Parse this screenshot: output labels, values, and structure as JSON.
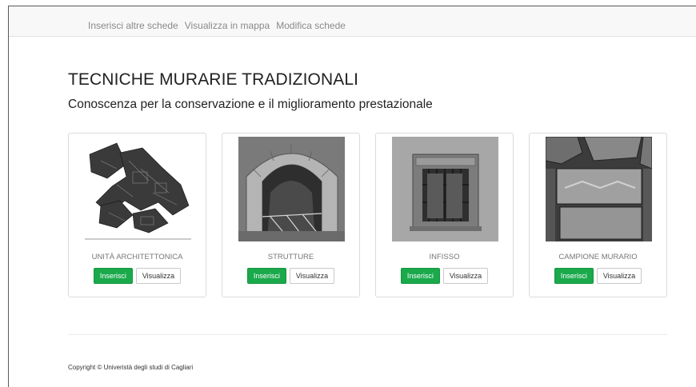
{
  "nav": {
    "links": [
      "Inserisci altre schede",
      "Visualizza in mappa",
      "Modifica schede"
    ]
  },
  "main": {
    "title": "TECNICHE MURARIE TRADIZIONALI",
    "subtitle": "Conoscenza per la conservazione e il miglioramento prestazionale"
  },
  "cards": [
    {
      "label": "UNITÀ ARCHITETTONICA",
      "insert_label": "Inserisci",
      "view_label": "Visualizza",
      "image": "architectural-plan"
    },
    {
      "label": "STRUTTURE",
      "insert_label": "Inserisci",
      "view_label": "Visualizza",
      "image": "stone-arch-photo"
    },
    {
      "label": "INFISSO",
      "insert_label": "Inserisci",
      "view_label": "Visualizza",
      "image": "ornate-window-photo"
    },
    {
      "label": "CAMPIONE MURARIO",
      "insert_label": "Inserisci",
      "view_label": "Visualizza",
      "image": "masonry-sample-photo"
    }
  ],
  "footer": {
    "copyright": "Copyright © Univeristà degli studi di Cagliari"
  },
  "colors": {
    "primary_button": "#1aa94b",
    "navbar_bg": "#f8f8f8",
    "nav_text": "#8a8a8a"
  }
}
